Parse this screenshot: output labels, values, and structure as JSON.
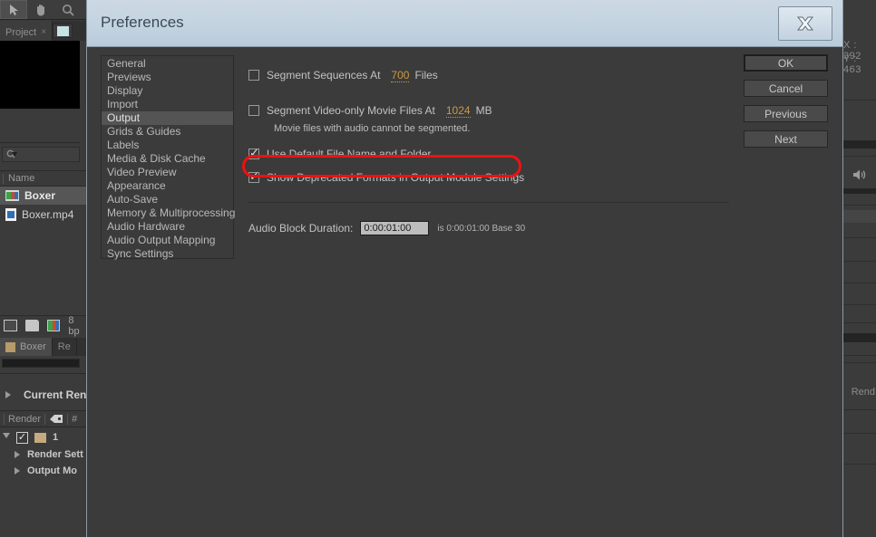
{
  "background_app": {
    "toolbar": {
      "tools": [
        {
          "name": "selection-tool",
          "label": "Selection"
        },
        {
          "name": "hand-tool",
          "label": "Hand"
        },
        {
          "name": "zoom-tool",
          "label": "Zoom"
        }
      ]
    },
    "project_panel": {
      "tab_label": "Project",
      "close_glyph": "×",
      "search_placeholder": "",
      "column_header": "Name",
      "items": [
        {
          "label": "Boxer",
          "icon": "composition-icon",
          "selected": true
        },
        {
          "label": "Boxer.mp4",
          "icon": "footage-file-icon",
          "selected": false
        }
      ],
      "footer": {
        "bit_depth": "8 bp"
      }
    },
    "render_queue_panel": {
      "tabs": [
        {
          "label": "Boxer",
          "active": true
        },
        {
          "label": "Re",
          "active": false
        }
      ],
      "current_render_label": "Current Ren",
      "columns": [
        "Render",
        "tag-icon",
        "#"
      ],
      "row_number": "1",
      "sub_rows": [
        "Render Sett",
        "Output Mo"
      ]
    },
    "right_panel": {
      "coord_x": "X : 392",
      "coord_y": "Y : 463",
      "render_label": "Rend"
    }
  },
  "dialog": {
    "title": "Preferences",
    "close_icon": "close-icon",
    "categories": [
      {
        "label": "General",
        "selected": false
      },
      {
        "label": "Previews",
        "selected": false
      },
      {
        "label": "Display",
        "selected": false
      },
      {
        "label": "Import",
        "selected": false
      },
      {
        "label": "Output",
        "selected": true
      },
      {
        "label": "Grids & Guides",
        "selected": false
      },
      {
        "label": "Labels",
        "selected": false
      },
      {
        "label": "Media & Disk Cache",
        "selected": false
      },
      {
        "label": "Video Preview",
        "selected": false
      },
      {
        "label": "Appearance",
        "selected": false
      },
      {
        "label": "Auto-Save",
        "selected": false
      },
      {
        "label": "Memory & Multiprocessing",
        "selected": false
      },
      {
        "label": "Audio Hardware",
        "selected": false
      },
      {
        "label": "Audio Output Mapping",
        "selected": false
      },
      {
        "label": "Sync Settings",
        "selected": false
      }
    ],
    "output_options": {
      "segment_sequences": {
        "label": "Segment Sequences At",
        "checked": false,
        "value": "700",
        "unit": "Files"
      },
      "segment_video_only": {
        "label": "Segment Video-only Movie Files At",
        "checked": false,
        "value": "1024",
        "unit": "MB"
      },
      "segment_note": "Movie files with audio cannot be segmented.",
      "use_default_name": {
        "label": "Use Default File Name and Folder",
        "checked": true
      },
      "show_deprecated": {
        "label": "Show Deprecated Formats in Output Module Settings",
        "checked": true
      },
      "audio_block": {
        "label": "Audio Block Duration:",
        "value": "0:00:01:00",
        "suffix": "is 0:00:01:00  Base 30"
      }
    },
    "buttons": [
      {
        "label": "OK",
        "primary": true
      },
      {
        "label": "Cancel",
        "primary": false
      },
      {
        "label": "Previous",
        "primary": false
      },
      {
        "label": "Next",
        "primary": false
      }
    ],
    "annotation": {
      "shape": "red-ellipse-highlight",
      "color": "#ee1111",
      "targets": "show_deprecated"
    }
  }
}
